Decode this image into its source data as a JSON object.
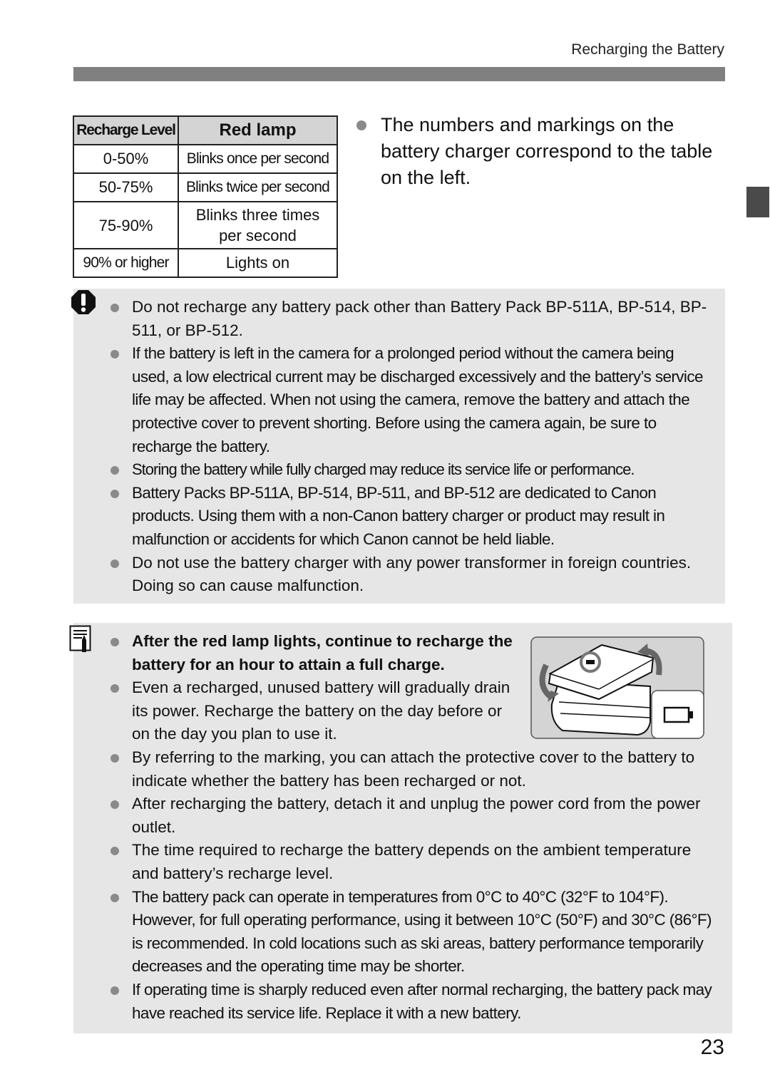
{
  "header": {
    "running_title": "Recharging the Battery"
  },
  "recharge_table": {
    "headers": [
      "Recharge Level",
      "Red lamp"
    ],
    "rows": [
      {
        "level": "0-50%",
        "lamp": "Blinks once per second"
      },
      {
        "level": "50-75%",
        "lamp": "Blinks twice per second"
      },
      {
        "level": "75-90%",
        "lamp_line1": "Blinks three times",
        "lamp_line2": "per second"
      },
      {
        "level": "90% or higher",
        "lamp": "Lights on"
      }
    ]
  },
  "intro_note": "The numbers and markings on the battery charger correspond to the table on the left.",
  "caution": {
    "icon": "caution-icon",
    "items": [
      "Do not recharge any battery pack other than Battery Pack BP-511A, BP-514, BP-511, or BP-512.",
      "If the battery is left in the camera for a prolonged period without the camera being used, a low electrical current may be discharged excessively and the battery’s service life may be affected. When not using the camera, remove the battery and attach the protective cover to prevent shorting. Before using the camera again, be sure to recharge the battery.",
      "Storing the battery while fully charged may reduce its service life or performance.",
      "Battery Packs BP-511A, BP-514, BP-511, and BP-512 are dedicated to Canon products. Using them with a non-Canon battery charger or product may result in malfunction or accidents for which Canon cannot be held liable.",
      "Do not use the battery charger with any power transformer in foreign countries. Doing so can cause malfunction."
    ]
  },
  "notes": {
    "icon": "memo-pencil-icon",
    "items": [
      "After the red lamp lights, continue to recharge the battery for an hour to attain a full charge.",
      "Even a recharged, unused battery will gradually drain its power. Recharge the battery on the day before or on the day you plan to use it.",
      "By referring to the marking, you can attach the protective cover to the battery to indicate whether the battery has been recharged or not.",
      "After recharging the battery, detach it and unplug the power cord from the power outlet.",
      "The time required to recharge the battery depends on the ambient temperature and battery’s recharge level.",
      "The battery pack can operate in temperatures from 0°C to 40°C (32°F to 104°F). However, for full operating performance, using it between 10°C (50°F) and 30°C (86°F) is recommended. In cold locations such as ski areas, battery performance temporarily decreases and the operating time may be shorter.",
      "If operating time is sharply reduced even after normal recharging, the battery pack may have reached its service life. Replace it with a new battery."
    ],
    "illustration": "battery-protective-cover-illustration"
  },
  "page_number": "23"
}
